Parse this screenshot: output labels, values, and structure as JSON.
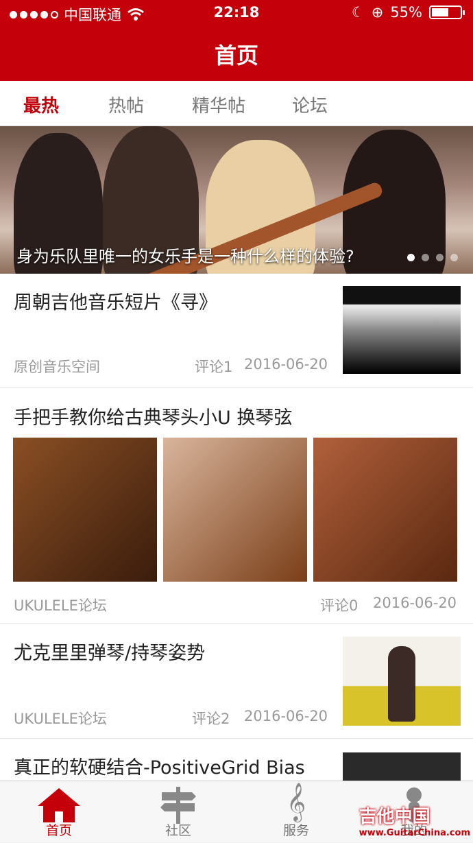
{
  "status": {
    "carrier": "中国联通",
    "time": "22:18",
    "battery": "55%"
  },
  "header": {
    "title": "首页"
  },
  "tabs": [
    "最热",
    "热帖",
    "精华帖",
    "论坛"
  ],
  "banner": {
    "caption": "身为乐队里唯一的女乐手是一种什么样的体验?"
  },
  "feed": [
    {
      "title": "周朝吉他音乐短片《寻》",
      "source": "原创音乐空间",
      "comments": "评论1",
      "date": "2016-06-20"
    },
    {
      "title": "手把手教你给古典琴头小U 换琴弦",
      "source": "UKULELE论坛",
      "comments": "评论0",
      "date": "2016-06-20"
    },
    {
      "title": "尤克里里弹琴/持琴姿势",
      "source": "UKULELE论坛",
      "comments": "评论2",
      "date": "2016-06-20"
    },
    {
      "title": "真正的软硬结合-PositiveGrid Bias"
    }
  ],
  "tabbar": [
    "首页",
    "社区",
    "服务",
    "我的"
  ],
  "watermark": {
    "brand": "吉他中国",
    "url": "www.GuitarChina.com"
  }
}
